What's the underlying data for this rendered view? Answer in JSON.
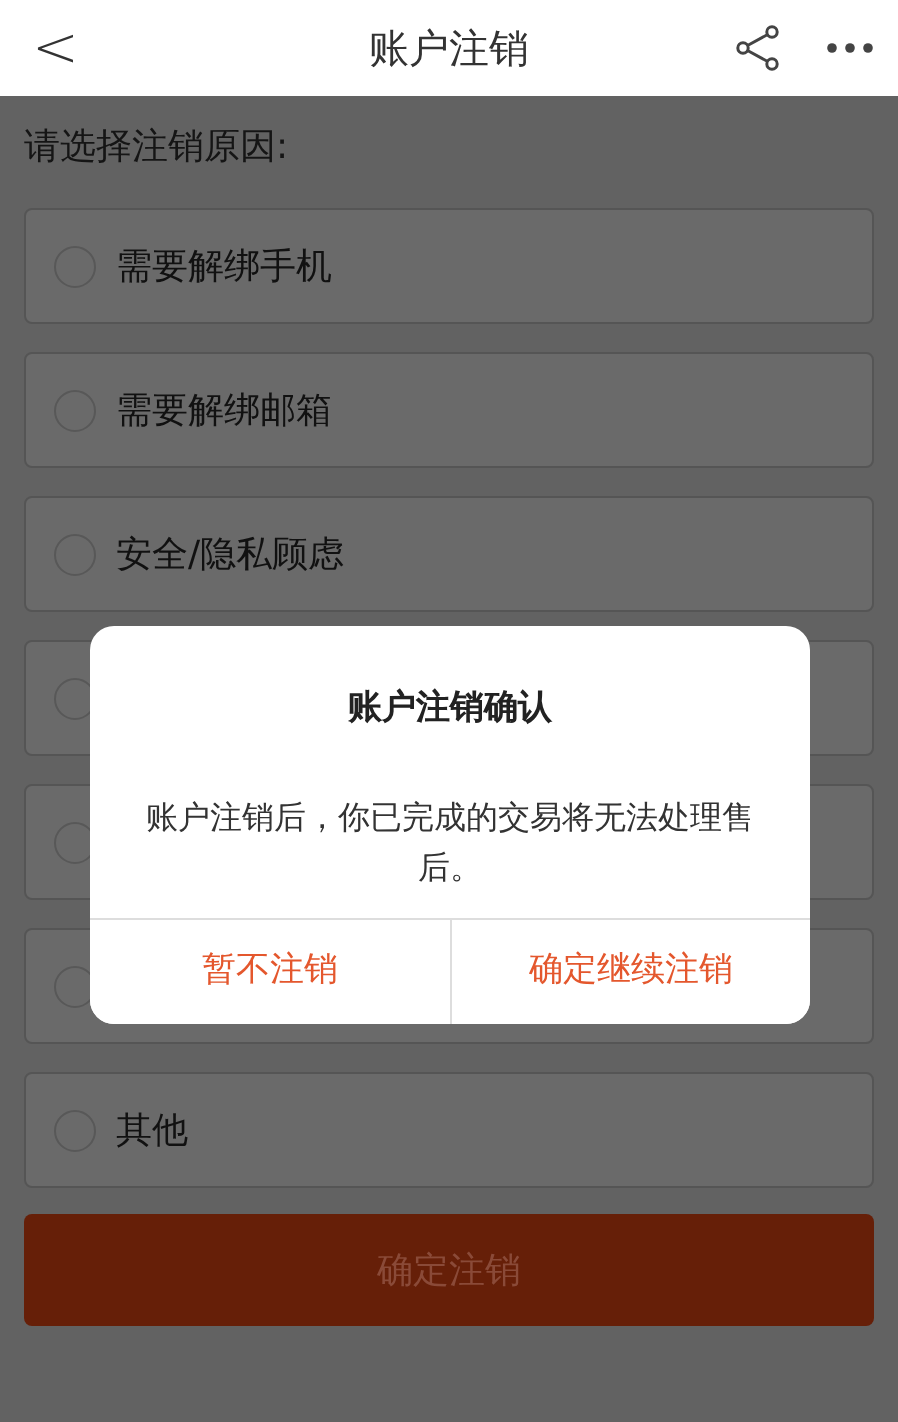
{
  "header": {
    "back": "<",
    "title": "账户注销"
  },
  "prompt": "请选择注销原因:",
  "options": [
    {
      "label": "需要解绑手机",
      "selected": false
    },
    {
      "label": "需要解绑邮箱",
      "selected": false
    },
    {
      "label": "安全/隐私顾虑",
      "selected": false
    },
    {
      "selected": false
    },
    {
      "selected": false
    },
    {
      "selected": false
    },
    {
      "label": "其他",
      "selected": false
    }
  ],
  "submit": "确定注销",
  "dialog": {
    "title": "账户注销确认",
    "message": "账户注销后，你已完成的交易将无法处理售后。",
    "buttons": [
      "暂不注销",
      "确定继续注销"
    ]
  }
}
